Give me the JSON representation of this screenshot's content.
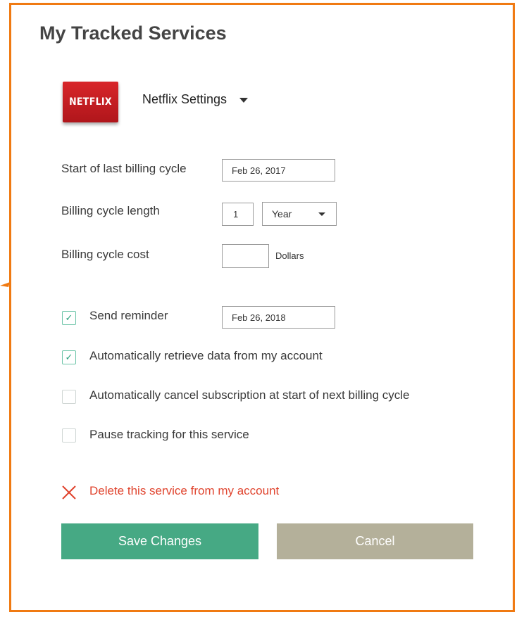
{
  "header": {
    "title": "My Tracked Services"
  },
  "service": {
    "logo_text": "NETFLIX",
    "selector_label": "Netflix Settings"
  },
  "billing": {
    "start_label": "Start of last billing cycle",
    "start_value": "Feb 26, 2017",
    "length_label": "Billing cycle length",
    "length_value": "1",
    "length_unit": "Year",
    "cost_label": "Billing cycle cost",
    "cost_value": "",
    "cost_unit": "Dollars"
  },
  "options": {
    "reminder": {
      "label": "Send reminder",
      "checked": true,
      "date": "Feb 26, 2018"
    },
    "auto_retrieve": {
      "label": "Automatically retrieve data from my account",
      "checked": true
    },
    "auto_cancel": {
      "label": "Automatically cancel subscription at start of next billing cycle",
      "checked": false
    },
    "pause": {
      "label": "Pause tracking for this service",
      "checked": false
    }
  },
  "delete": {
    "label": "Delete this service from my account",
    "icon": "close-icon"
  },
  "actions": {
    "save_label": "Save Changes",
    "cancel_label": "Cancel"
  },
  "colors": {
    "frame": "#f07a12",
    "save": "#46a984",
    "cancel": "#b4b09a",
    "danger": "#e0442e",
    "brand": "#d8262a"
  }
}
